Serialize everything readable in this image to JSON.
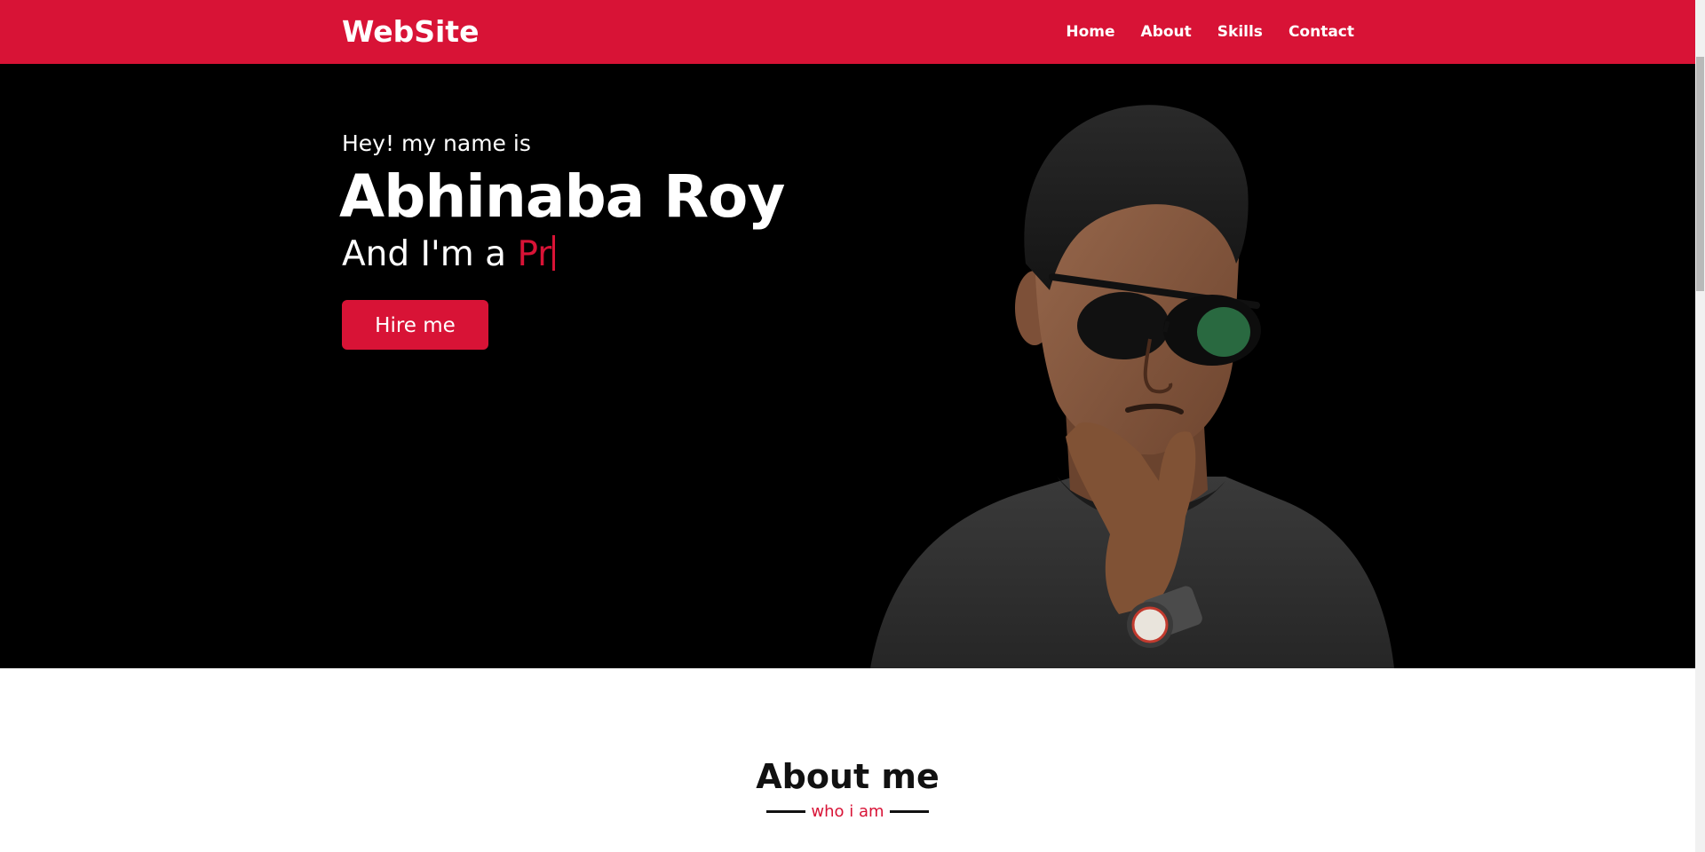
{
  "navbar": {
    "logo": "WebSite",
    "menu": [
      {
        "label": "Home"
      },
      {
        "label": "About"
      },
      {
        "label": "Skills"
      },
      {
        "label": "Contact"
      }
    ]
  },
  "hero": {
    "greeting": "Hey! my name is",
    "name": "Abhinaba Roy",
    "tagline_prefix": "And I'm a ",
    "typed_text": "Pr",
    "hire_button": "Hire me",
    "portrait_alt": "Portrait of Abhinaba Roy wearing sunglasses"
  },
  "about": {
    "title": "About me",
    "subtitle": "who i am"
  },
  "colors": {
    "accent": "#d81336",
    "hero_bg": "#000000",
    "nav_text": "#ffffff"
  }
}
